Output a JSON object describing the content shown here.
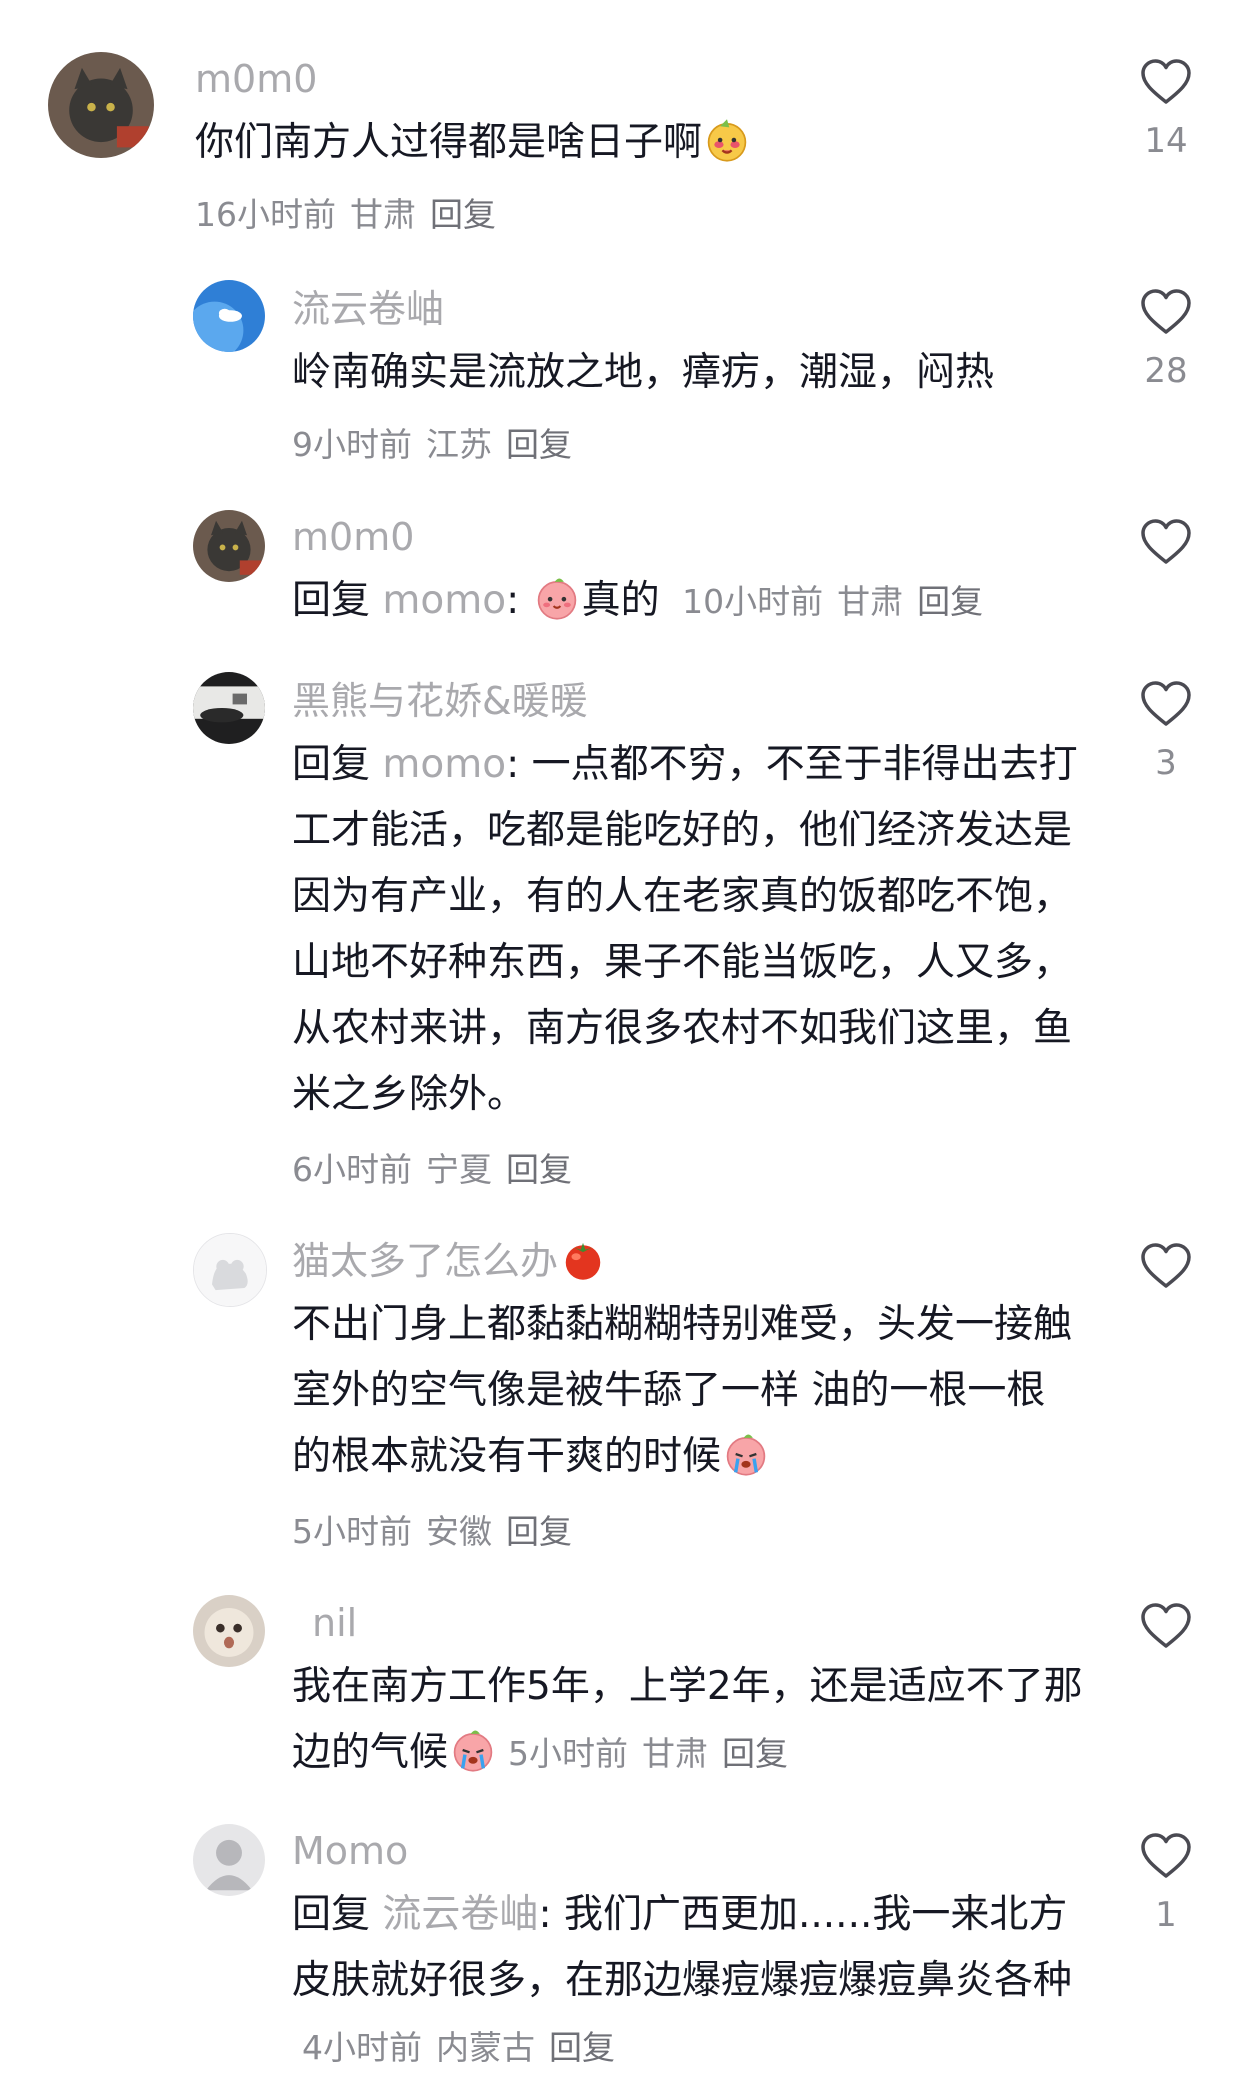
{
  "comments": [
    {
      "username": "m0m0",
      "text": "你们南方人过得都是啥日子啊",
      "time": "16小时前",
      "location": "甘肃",
      "reply_label": "回复",
      "likes": "14",
      "emoji": "cheeky-face-emoji"
    },
    {
      "username": "流云卷岫",
      "text": "岭南确实是流放之地，瘴疠，潮湿，闷热",
      "time": "9小时前",
      "location": "江苏",
      "reply_label": "回复",
      "likes": "28"
    },
    {
      "username": "m0m0",
      "reply_prefix": "回复",
      "reply_to": "momo",
      "text": "真的",
      "time": "10小时前",
      "location": "甘肃",
      "reply_label": "回复",
      "likes": "",
      "emoji": "peach-face-emoji"
    },
    {
      "username": "黑熊与花娇&暖暖",
      "reply_prefix": "回复",
      "reply_to": "momo",
      "text": "一点都不穷，不至于非得出去打工才能活，吃都是能吃好的，他们经济发达是因为有产业，有的人在老家真的饭都吃不饱，山地不好种东西，果子不能当饭吃，人又多，从农村来讲，南方很多农村不如我们这里，鱼米之乡除外。",
      "time": "6小时前",
      "location": "宁夏",
      "reply_label": "回复",
      "likes": "3"
    },
    {
      "username": "猫太多了怎么办",
      "text": "不出门身上都黏黏糊糊特别难受，头发一接触室外的空气像是被牛舔了一样 油的一根一根的根本就没有干爽的时候",
      "time": "5小时前",
      "location": "安徽",
      "reply_label": "回复",
      "likes": "",
      "name_emoji": "tomato-emoji",
      "emoji": "crying-face-emoji"
    },
    {
      "username": "nil",
      "text": "我在南方工作5年，上学2年，还是适应不了那边的气候",
      "time": "5小时前",
      "location": "甘肃",
      "reply_label": "回复",
      "likes": "",
      "emoji": "crying-face-emoji"
    },
    {
      "username": "Momo",
      "reply_prefix": "回复",
      "reply_to": "流云卷岫",
      "text": "我们广西更加......我一来北方皮肤就好很多，在那边爆痘爆痘爆痘鼻炎各种",
      "time": "4小时前",
      "location": "内蒙古",
      "reply_label": "回复",
      "likes": "1"
    }
  ],
  "colors": {
    "username": "#a9a9ad",
    "text": "#161823",
    "meta": "#8a8b91"
  }
}
